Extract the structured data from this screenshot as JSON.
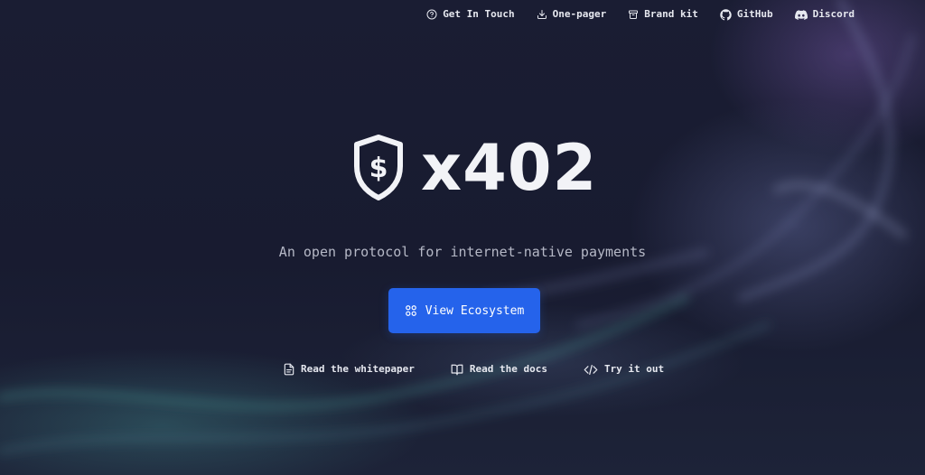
{
  "nav": {
    "items": [
      {
        "label": "Get In Touch",
        "icon": "help-circle-icon"
      },
      {
        "label": "One-pager",
        "icon": "download-icon"
      },
      {
        "label": "Brand kit",
        "icon": "archive-icon"
      },
      {
        "label": "GitHub",
        "icon": "github-icon"
      },
      {
        "label": "Discord",
        "icon": "discord-icon"
      }
    ]
  },
  "hero": {
    "logo_text": "x402",
    "logo_icon": "shield-dollar-icon",
    "tagline": "An open protocol for internet-native payments",
    "cta": {
      "label": "View Ecosystem",
      "icon": "grid-icon"
    }
  },
  "links": [
    {
      "label": "Read the whitepaper",
      "icon": "file-icon"
    },
    {
      "label": "Read the docs",
      "icon": "book-open-icon"
    },
    {
      "label": "Try it out",
      "icon": "code-icon"
    }
  ],
  "colors": {
    "accent": "#2563eb",
    "background": "#181b30",
    "text": "#e6e8ef"
  }
}
